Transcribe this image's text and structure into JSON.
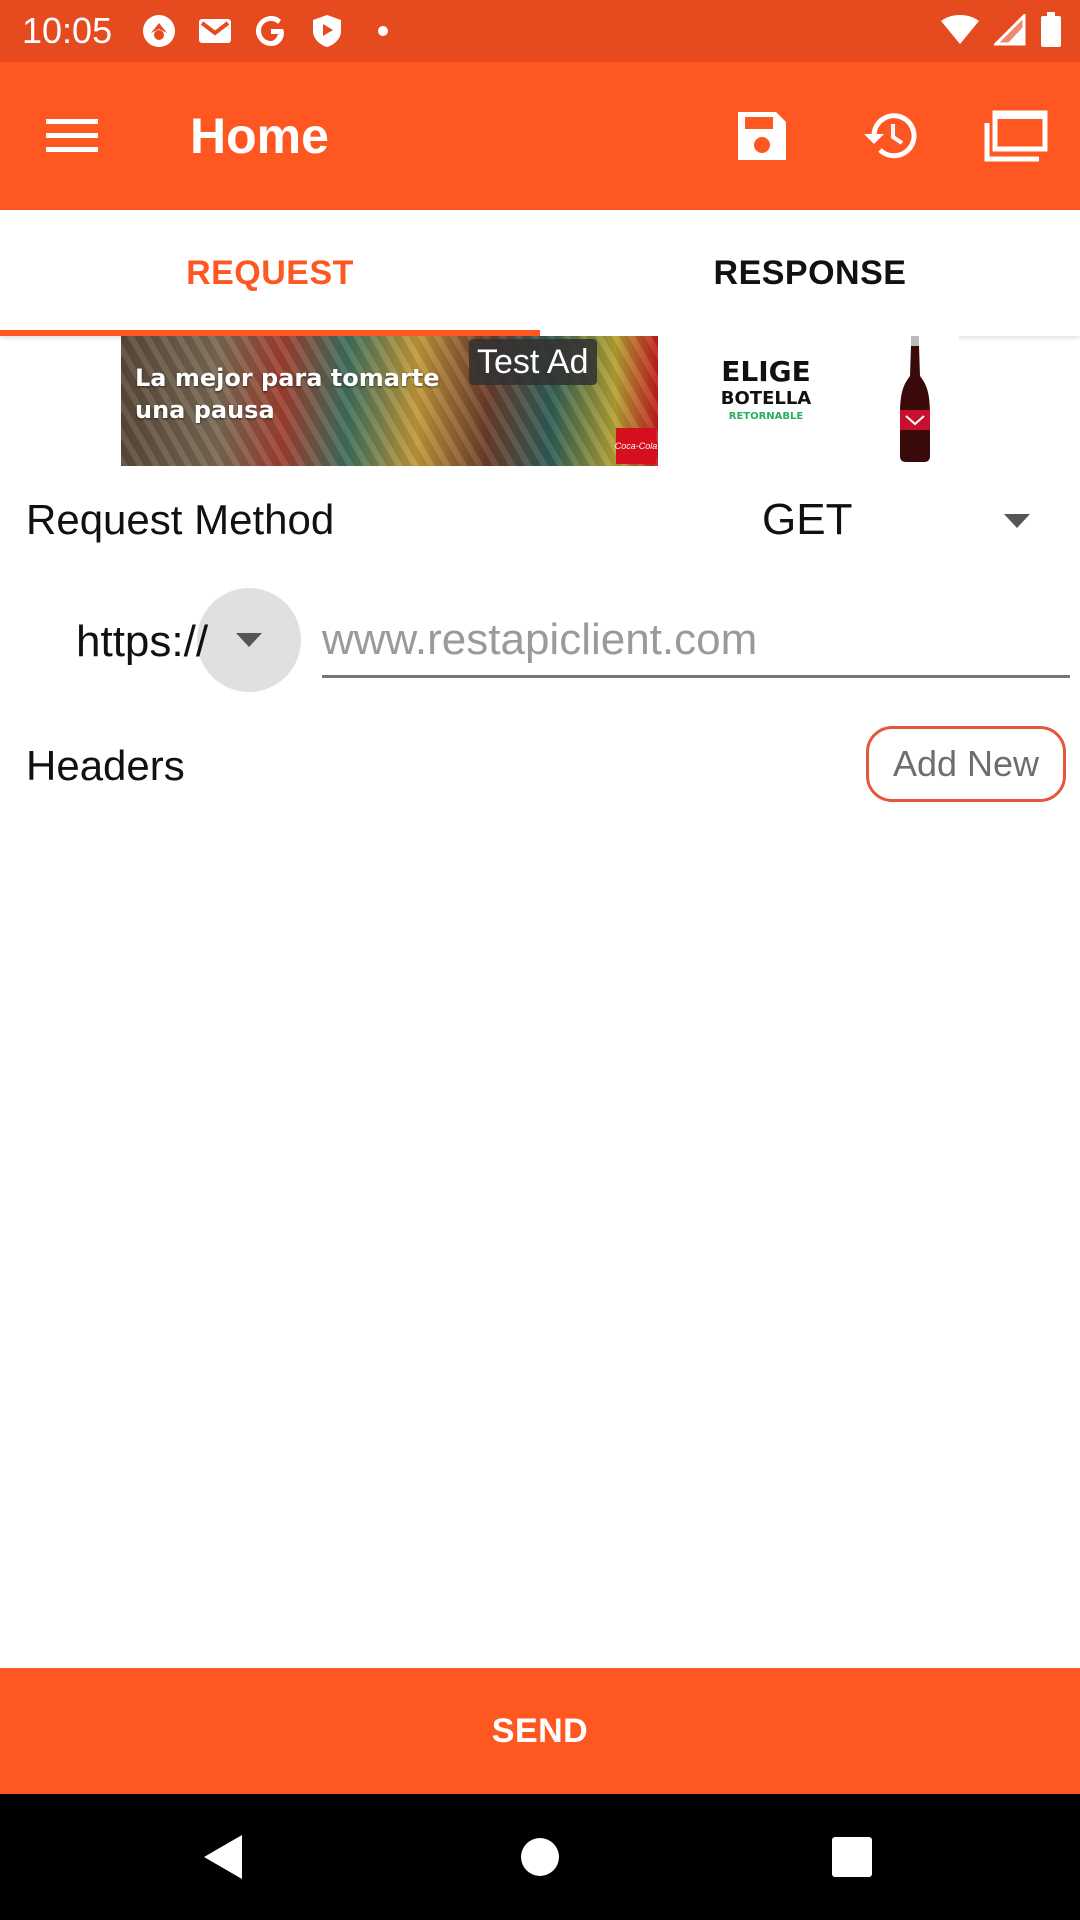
{
  "status_bar": {
    "time": "10:05",
    "left_icons": [
      "app-notification-icon",
      "gmail-icon",
      "google-icon",
      "shield-play-icon",
      "dot-icon"
    ],
    "right_icons": [
      "wifi-icon",
      "cellular-signal-icon",
      "battery-icon"
    ]
  },
  "app_bar": {
    "title": "Home",
    "icons": [
      "menu-icon",
      "save-icon",
      "history-icon",
      "collections-icon"
    ],
    "background": "#ff5722"
  },
  "tabs": [
    {
      "label": "REQUEST",
      "selected": true
    },
    {
      "label": "RESPONSE",
      "selected": false
    }
  ],
  "ad": {
    "headline": "La mejor para tomarte una pausa",
    "badge": "Test Ad",
    "right_line1": "ELIGE",
    "right_line2": "BOTELLA",
    "right_line3": "RETORNABLE"
  },
  "request": {
    "method_label": "Request Method",
    "method_value": "GET",
    "scheme": "https://",
    "url_placeholder": "www.restapiclient.com",
    "url_value": ""
  },
  "headers": {
    "label": "Headers",
    "add_new_label": "Add New"
  },
  "send_label": "SEND",
  "colors": {
    "accent": "#ff5722",
    "status_bar": "#e54b1e"
  }
}
